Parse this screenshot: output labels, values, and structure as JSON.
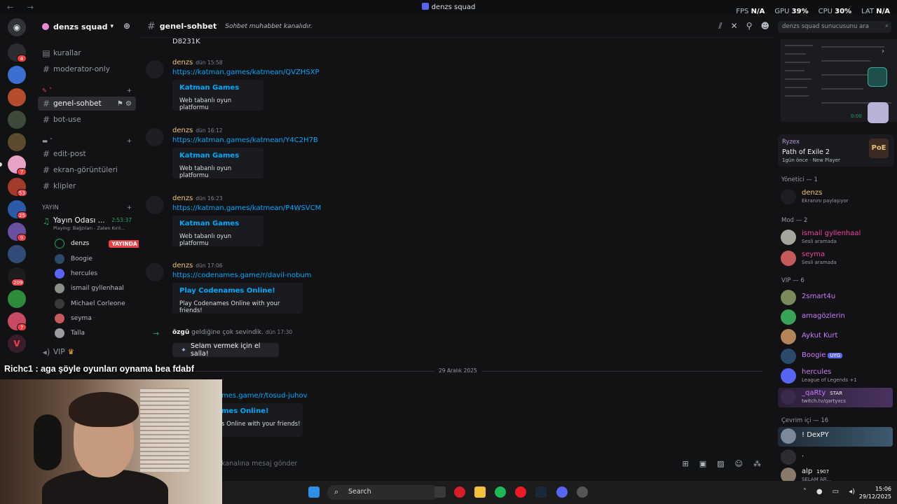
{
  "window": {
    "title": "denzs squad",
    "stats": [
      {
        "label": "FPS",
        "value": "N/A"
      },
      {
        "label": "GPU",
        "value": "39%"
      },
      {
        "label": "CPU",
        "value": "30%"
      },
      {
        "label": "LAT",
        "value": "N/A"
      }
    ]
  },
  "rail": {
    "badges": [
      "4",
      "7",
      "53",
      "25",
      "9",
      "209",
      "7"
    ]
  },
  "server": {
    "name": "denzs squad",
    "channels": {
      "kurallar": "kurallar",
      "moderator": "moderator-only",
      "genel": "genel-sohbet",
      "bot": "bot-use",
      "edit": "edit-post",
      "ekran": "ekran-görüntüleri",
      "klipler": "klipler"
    },
    "category_yayin": "YAYIN",
    "voice": {
      "name": "Yayın Odası ...",
      "timer": "2:53:37",
      "activity": "Playing: Bağzıları - Zaten Kırıl...",
      "live_label": "YAYINDA",
      "users": [
        "denzs",
        "Boogie",
        "hercules",
        "ismail gyllenhaal",
        "Michael Corleone",
        "seyma",
        "Talla"
      ]
    },
    "vip_label": "VIP"
  },
  "chat": {
    "channel": "genel-sohbet",
    "topic": "Sohbet muhabbet kanalıdır.",
    "search_placeholder": "denzs squad sunucusunu ara",
    "top_code": "D8231K",
    "messages": [
      {
        "author": "denzs",
        "time": "dün 15:58",
        "link": "https://katman.games/katmean/QVZHSXP",
        "embed_title": "Katman Games",
        "embed_desc": "Web tabanlı oyun platformu"
      },
      {
        "author": "denzs",
        "time": "dün 16:12",
        "link": "https://katman.games/katmean/Y4C2H7B",
        "embed_title": "Katman Games",
        "embed_desc": "Web tabanlı oyun platformu"
      },
      {
        "author": "denzs",
        "time": "dün 16:23",
        "link": "https://katman.games/katmean/P4WSVCM",
        "embed_title": "Katman Games",
        "embed_desc": "Web tabanlı oyun platformu"
      },
      {
        "author": "denzs",
        "time": "dün 17:06",
        "link": "https://codenames.game/r/davil-nobum",
        "embed_title": "Play Codenames Online!",
        "embed_desc": "Play Codenames Online with your friends!"
      }
    ],
    "join": {
      "user": "özgü",
      "text": "geldiğine çok sevindik.",
      "time": "dün 17:30"
    },
    "wave_button": "Selam vermek için el salla!",
    "date_divider": "29 Aralık 2025",
    "partial_link": "mes.game/r/tosud-juhov",
    "partial_embed_title": "mes Online!",
    "partial_embed_desc": "s Online with your friends!",
    "composer_placeholder": "kanalına mesaj gönder"
  },
  "members": {
    "activity": {
      "user": "Ryzex",
      "game": "Path of Exile 2",
      "status": "1gün önce",
      "party": "New Player",
      "logo": "PoE"
    },
    "mini_timer": "0:00",
    "groups": {
      "yonetici": "Yönetici — 1",
      "mod": "Mod — 2",
      "vip": "VIP — 6",
      "online": "Çevrim içi — 16"
    },
    "list": [
      {
        "name": "denzs",
        "status": "Ekranını paylaşıyor",
        "color": "#f0c674"
      },
      {
        "name": "ismail gyllenhaal",
        "status": "Sesli aramada",
        "color": "#eb459e"
      },
      {
        "name": "seyma",
        "status": "Sesli aramada",
        "color": "#eb459e"
      },
      {
        "name": "2smart4u",
        "status": "",
        "color": "#c77dff"
      },
      {
        "name": "amagözlerin",
        "status": "",
        "color": "#c77dff"
      },
      {
        "name": "Aykut Kurt",
        "status": "",
        "color": "#c77dff"
      },
      {
        "name": "Boogie",
        "status": "",
        "color": "#c77dff",
        "tag": "UYG"
      },
      {
        "name": "hercules",
        "status": "League of Legends +1",
        "color": "#c77dff"
      },
      {
        "name": "_qaRty",
        "status": "twitch.tv/qartyxcs",
        "color": "#c77dff",
        "tag": "STAR"
      },
      {
        "name": "! DexPY",
        "status": "",
        "color": "#f2f3f5"
      },
      {
        "name": ".",
        "status": "",
        "color": "#f2f3f5"
      },
      {
        "name": "alp",
        "status": "SELAM AR...",
        "color": "#f2f3f5",
        "tag": "1907"
      }
    ]
  },
  "overlay": {
    "chat_line": "Richc1 : aga şöyle oyunları oynama bea fdabf"
  },
  "taskbar": {
    "search": "Search",
    "time": "15:06",
    "date": "29/12/2025"
  }
}
